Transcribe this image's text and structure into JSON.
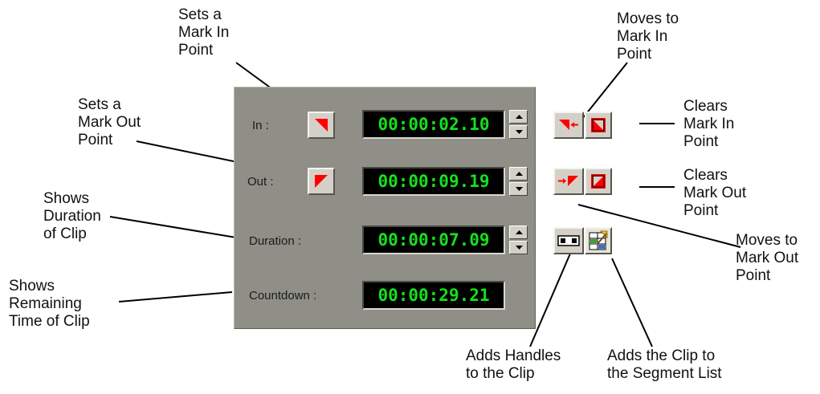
{
  "panel": {
    "rows": [
      {
        "label": "In :",
        "timecode": "00:00:02.10"
      },
      {
        "label": "Out :",
        "timecode": "00:00:09.19"
      },
      {
        "label": "Duration :",
        "timecode": "00:00:07.09"
      },
      {
        "label": "Countdown :",
        "timecode": "00:00:29.21"
      }
    ],
    "colors": {
      "background": "#8f8f87",
      "timecode_text": "#16e01c",
      "timecode_bg": "#000000",
      "mark_red": "#ff0000"
    }
  },
  "icons": {
    "set_in": "mark-in-icon",
    "set_out": "mark-out-icon",
    "goto_in": "go-to-mark-in-icon",
    "clear_in": "clear-mark-in-icon",
    "goto_out": "go-to-mark-out-icon",
    "clear_out": "clear-mark-out-icon",
    "handles": "add-handles-icon",
    "segment": "add-to-segment-list-icon"
  },
  "callouts": {
    "set_in": "Sets a\nMark In\nPoint",
    "set_out": "Sets a\nMark Out\nPoint",
    "duration": "Shows\nDuration\nof Clip",
    "remaining": "Shows\nRemaining\nTime of Clip",
    "goto_in": "Moves to\nMark In\nPoint",
    "clear_in": "Clears\nMark In\nPoint",
    "clear_out": "Clears\nMark Out\nPoint",
    "goto_out": "Moves to\nMark Out\nPoint",
    "handles": "Adds Handles\nto the Clip",
    "segment": "Adds the Clip to\nthe Segment List"
  }
}
